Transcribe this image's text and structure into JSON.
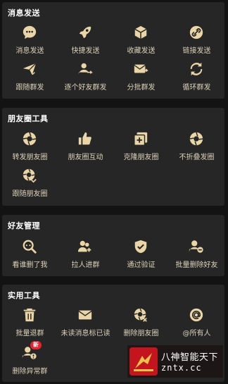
{
  "colors": {
    "icon": "#ead5a6",
    "label": "#dcd2b8",
    "title": "#ffffff",
    "card": "#262626",
    "bg": "#131313",
    "badge": "#e8232d"
  },
  "sections": {
    "message_send": {
      "title": "消息发送",
      "items": [
        {
          "label": "消息发送",
          "icon": "chat-send-icon"
        },
        {
          "label": "快捷发送",
          "icon": "rocket-icon"
        },
        {
          "label": "收藏发送",
          "icon": "cube-icon"
        },
        {
          "label": "链接发送",
          "icon": "link-icon"
        },
        {
          "label": "跟随群发",
          "icon": "paper-plane-icon"
        },
        {
          "label": "逐个好友群发",
          "icon": "user-send-icon"
        },
        {
          "label": "分批群发",
          "icon": "mail-batch-icon"
        },
        {
          "label": "循环群发",
          "icon": "loop-icon"
        }
      ]
    },
    "moments": {
      "title": "朋友圈工具",
      "items": [
        {
          "label": "转发朋友圈",
          "icon": "aperture-icon"
        },
        {
          "label": "朋友圈互动",
          "icon": "thumbs-up-icon"
        },
        {
          "label": "克隆朋友圈",
          "icon": "clone-icon"
        },
        {
          "label": "不折叠发圈",
          "icon": "aperture-icon"
        },
        {
          "label": "跟随朋友圈",
          "icon": "aperture-shuffle-icon"
        }
      ]
    },
    "friends": {
      "title": "好友管理",
      "items": [
        {
          "label": "看谁删了我",
          "icon": "search-chat-icon"
        },
        {
          "label": "拉人进群",
          "icon": "add-group-icon"
        },
        {
          "label": "通过验证",
          "icon": "shield-check-icon"
        },
        {
          "label": "批量删除好友",
          "icon": "user-remove-icon"
        }
      ]
    },
    "utilities": {
      "title": "实用工具",
      "items": [
        {
          "label": "批量退群",
          "icon": "trash-icon"
        },
        {
          "label": "未读消息标已读",
          "icon": "envelope-icon"
        },
        {
          "label": "删除朋友圈",
          "icon": "aperture-delete-icon"
        },
        {
          "label": "@所有人",
          "icon": "at-icon"
        },
        {
          "label": "删除异常群",
          "icon": "user-alert-icon",
          "badge": "新"
        }
      ]
    }
  },
  "watermark": {
    "line1": "八神智能天下",
    "line2": "zntx.cc"
  }
}
